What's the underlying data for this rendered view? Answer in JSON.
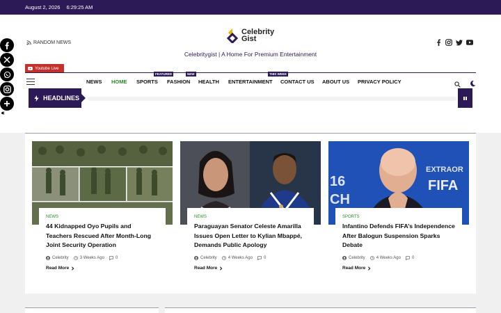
{
  "topbar": {
    "date": "August 2, 2026",
    "time": "6:29:25 AM"
  },
  "header": {
    "random_news": "RANDOM NEWS",
    "logo_line1": "Celebrity",
    "logo_line2": "Gist",
    "tagline": "Celebritygist | A Home For Premium Entertainment",
    "youtube_live": "Youtube Live"
  },
  "nav": {
    "items": [
      {
        "label": "NEWS",
        "badge": ""
      },
      {
        "label": "HOME",
        "badge": ""
      },
      {
        "label": "SPORTS",
        "badge": "FEATURED"
      },
      {
        "label": "FASHION",
        "badge": "NEW"
      },
      {
        "label": "HEALTH",
        "badge": ""
      },
      {
        "label": "ENTERTAINMENT",
        "badge": "THIS WEEK"
      },
      {
        "label": "CONTACT US",
        "badge": ""
      },
      {
        "label": "ABOUT US",
        "badge": ""
      },
      {
        "label": "PRIVACY POLICY",
        "badge": ""
      }
    ]
  },
  "headlines": {
    "label": "HEADLINES"
  },
  "cards": [
    {
      "category": "NEWS",
      "title": "44 Kidnapped Oyo Pupils and Teachers Rescued After Month-Long Joint Security Operation",
      "author": "Celebrity",
      "time": "3 Weeks Ago",
      "comments": "0",
      "read_more": "Read More"
    },
    {
      "category": "NEWS",
      "title": "Paraguayan Senator Celeste Amarilla Issues Open Letter to Kylian Mbappé, Demands Public Apology",
      "author": "Celebrity",
      "time": "4 Weeks Ago",
      "comments": "0",
      "read_more": "Read More"
    },
    {
      "category": "SPORTS",
      "title": "Infantino Defends FIFA’s Independence After Balogun Suspension Sparks Debate",
      "author": "Celebrity",
      "time": "4 Weeks Ago",
      "comments": "0",
      "read_more": "Read More"
    }
  ],
  "card3_image_text": {
    "left": "16",
    "left2": "CH",
    "right": "EXTRAOR",
    "right2": "FIFA"
  },
  "colors": {
    "brand": "#2b1a55",
    "accent_green": "#2a8a2a",
    "youtube_red": "#c4302b"
  },
  "icons": [
    "rss-icon",
    "facebook-icon",
    "instagram-icon",
    "twitter-icon",
    "youtube-icon",
    "search-icon",
    "moon-icon",
    "bolt-icon",
    "pause-icon",
    "user-icon",
    "clock-icon",
    "comment-icon",
    "chevron-right-icon",
    "hamburger-icon",
    "share-icon"
  ]
}
